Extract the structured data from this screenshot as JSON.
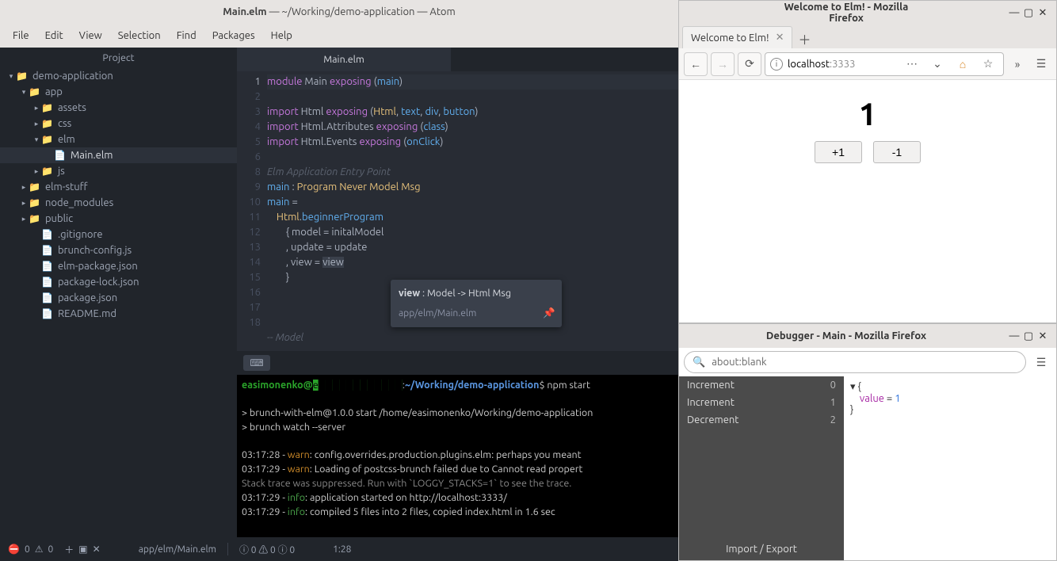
{
  "atom": {
    "title_file": "Main.elm",
    "title_path": "~/Working/demo-application",
    "title_app": "Atom",
    "menus": [
      "File",
      "Edit",
      "View",
      "Selection",
      "Find",
      "Packages",
      "Help"
    ],
    "project_label": "Project",
    "tree": [
      {
        "indent": 0,
        "arrow": "▾",
        "icon": "folder",
        "label": "demo-application"
      },
      {
        "indent": 1,
        "arrow": "▾",
        "icon": "folder",
        "label": "app"
      },
      {
        "indent": 2,
        "arrow": "▸",
        "icon": "folder",
        "label": "assets"
      },
      {
        "indent": 2,
        "arrow": "▸",
        "icon": "folder",
        "label": "css"
      },
      {
        "indent": 2,
        "arrow": "▾",
        "icon": "folder",
        "label": "elm"
      },
      {
        "indent": 3,
        "arrow": "",
        "icon": "file",
        "label": "Main.elm",
        "selected": true
      },
      {
        "indent": 2,
        "arrow": "▸",
        "icon": "folder",
        "label": "js"
      },
      {
        "indent": 1,
        "arrow": "▸",
        "icon": "folder",
        "label": "elm-stuff"
      },
      {
        "indent": 1,
        "arrow": "▸",
        "icon": "folder",
        "label": "node_modules"
      },
      {
        "indent": 1,
        "arrow": "▸",
        "icon": "folder",
        "label": "public"
      },
      {
        "indent": 2,
        "arrow": "",
        "icon": "file",
        "label": ".gitignore"
      },
      {
        "indent": 2,
        "arrow": "",
        "icon": "file",
        "label": "brunch-config.js"
      },
      {
        "indent": 2,
        "arrow": "",
        "icon": "file",
        "label": "elm-package.json"
      },
      {
        "indent": 2,
        "arrow": "",
        "icon": "file",
        "label": "package-lock.json"
      },
      {
        "indent": 2,
        "arrow": "",
        "icon": "file",
        "label": "package.json"
      },
      {
        "indent": 2,
        "arrow": "",
        "icon": "file",
        "label": "README.md"
      }
    ],
    "tab_label": "Main.elm",
    "tooltip_sig_name": "view",
    "tooltip_sig_rest": " : Model -> Html Msg",
    "tooltip_loc": "app/elm/Main.elm",
    "terminal": {
      "user": "easimonenko@",
      "host_hidden": "e████████████",
      "cwd": "~/Working/demo-application",
      "cmd": "npm start",
      "out1": "> brunch-with-elm@1.0.0 start /home/easimonenko/Working/demo-application",
      "out2": "> brunch watch --server",
      "l1_t": "03:17:28 - ",
      "l1_lvl": "warn",
      "l1_m": ": config.overrides.production.plugins.elm: perhaps you meant ",
      "l2_t": "03:17:29 - ",
      "l2_lvl": "warn",
      "l2_m": ": Loading of postcss-brunch failed due to Cannot read propert",
      "l3": "Stack trace was suppressed. Run with `LOGGY_STACKS=1` to see the trace.",
      "l4_t": "03:17:29 - ",
      "l4_lvl": "info",
      "l4_m": ": application started on http://localhost:3333/",
      "l5_t": "03:17:29 - ",
      "l5_lvl": "info",
      "l5_m": ": compiled 5 files into 2 files, copied index.html in 1.6 sec"
    },
    "status": {
      "errors": "0",
      "warnings": "0",
      "file": "app/elm/Main.elm",
      "diag2": "ⓘ 0 ⚠ 0 ⓘ 0",
      "cursor": "1:28"
    }
  },
  "firefox": {
    "title": "Welcome to Elm! - Mozilla Firefox",
    "tab": "Welcome to Elm!",
    "url_host": "localhost",
    "url_port": ":3333",
    "counter": "1",
    "plus": "+1",
    "minus": "-1"
  },
  "debugger": {
    "title": "Debugger - Main - Mozilla Firefox",
    "url": "about:blank",
    "events": [
      {
        "name": "Increment",
        "n": "0"
      },
      {
        "name": "Increment",
        "n": "1"
      },
      {
        "name": "Decrement",
        "n": "2"
      }
    ],
    "state_open": "▾ {",
    "state_key": "value",
    "state_eq": " = ",
    "state_val": "1",
    "state_close": "  }",
    "footer": "Import / Export"
  },
  "code": {
    "ln": [
      "1",
      "2",
      "3",
      "4",
      "5",
      "6",
      "",
      "8",
      "9",
      "10",
      "11",
      "12",
      "13",
      "14",
      "15",
      "16",
      "17",
      "18"
    ],
    "comment_ep": "Elm Application Entry Point",
    "comment_model": "-- Model"
  }
}
